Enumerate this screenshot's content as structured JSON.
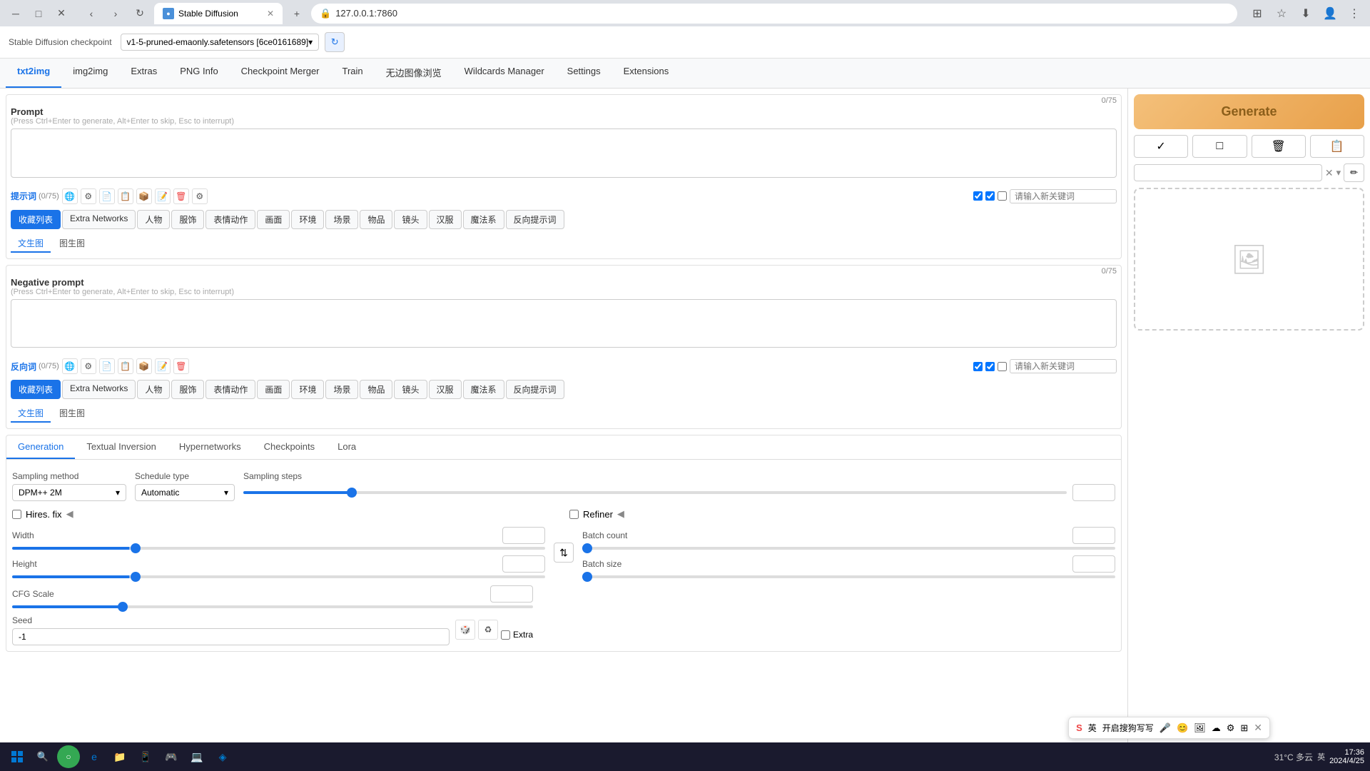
{
  "browser": {
    "tab_title": "Stable Diffusion",
    "url": "127.0.0.1:7860",
    "favicon": "SD"
  },
  "app": {
    "checkpoint_label": "Stable Diffusion checkpoint",
    "checkpoint_value": "v1-5-pruned-emaonly.safetensors [6ce0161689]",
    "nav_tabs": [
      {
        "label": "txt2img",
        "active": true
      },
      {
        "label": "img2img",
        "active": false
      },
      {
        "label": "Extras",
        "active": false
      },
      {
        "label": "PNG Info",
        "active": false
      },
      {
        "label": "Checkpoint Merger",
        "active": false
      },
      {
        "label": "Train",
        "active": false
      },
      {
        "label": "无边图像浏览",
        "active": false
      },
      {
        "label": "Wildcards Manager",
        "active": false
      },
      {
        "label": "Settings",
        "active": false
      },
      {
        "label": "Extensions",
        "active": false
      }
    ]
  },
  "prompt": {
    "label": "Prompt",
    "hint": "(Press Ctrl+Enter to generate, Alt+Enter to skip, Esc to interrupt)",
    "char_count": "0/75",
    "toolbar_label": "提示词",
    "toolbar_count": "(0/75)",
    "keyword_placeholder": "请输入新关键词",
    "sub_tabs": [
      "收藏列表",
      "Extra Networks",
      "人物",
      "服饰",
      "表情动作",
      "画面",
      "环境",
      "场景",
      "物品",
      "镜头",
      "汉服",
      "魔法系",
      "反向提示词"
    ],
    "inner_tabs": [
      "文生图",
      "图生图"
    ]
  },
  "negative_prompt": {
    "label": "Negative prompt",
    "hint": "(Press Ctrl+Enter to generate, Alt+Enter to skip, Esc to interrupt)",
    "char_count": "0/75",
    "toolbar_label": "反向词",
    "toolbar_count": "(0/75)",
    "keyword_placeholder": "请输入新关键词",
    "sub_tabs": [
      "收藏列表",
      "Extra Networks",
      "人物",
      "服饰",
      "表情动作",
      "画面",
      "环境",
      "场景",
      "物品",
      "镜头",
      "汉服",
      "魔法系",
      "反向提示词"
    ],
    "inner_tabs": [
      "文生图",
      "图生图"
    ]
  },
  "generation": {
    "tabs": [
      "Generation",
      "Textual Inversion",
      "Hypernetworks",
      "Checkpoints",
      "Lora"
    ],
    "sampling_method_label": "Sampling method",
    "sampling_method_value": "DPM++ 2M",
    "schedule_type_label": "Schedule type",
    "schedule_type_value": "Automatic",
    "sampling_steps_label": "Sampling steps",
    "sampling_steps_value": "20",
    "hires_fix_label": "Hires. fix",
    "refiner_label": "Refiner",
    "width_label": "Width",
    "width_value": "512",
    "height_label": "Height",
    "height_value": "512",
    "batch_count_label": "Batch count",
    "batch_count_value": "1",
    "batch_size_label": "Batch size",
    "batch_size_value": "1",
    "cfg_scale_label": "CFG Scale",
    "cfg_scale_value": "7",
    "seed_label": "Seed",
    "seed_value": "-1",
    "extra_label": "Extra"
  },
  "right_panel": {
    "generate_btn": "Generate",
    "action_btns": [
      "✓",
      "□",
      "🗑",
      "📋"
    ]
  },
  "taskbar": {
    "time": "17:36",
    "date": "2024/4/25",
    "weather": "31°C 多云",
    "lang": "英"
  },
  "sogou": {
    "text": "开启搜狗写写",
    "lang": "英"
  }
}
